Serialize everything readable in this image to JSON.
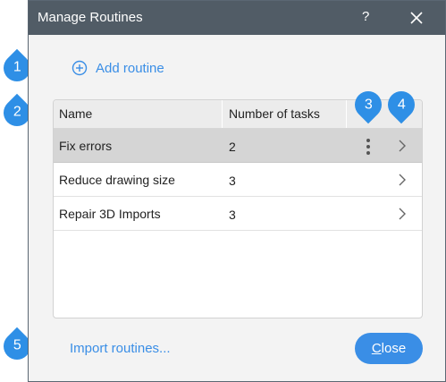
{
  "window": {
    "title": "Manage Routines",
    "help_label": "?"
  },
  "add_routine_label": "Add routine",
  "table": {
    "headers": {
      "name": "Name",
      "count": "Number of tasks"
    },
    "rows": [
      {
        "name": "Fix errors",
        "count": "2",
        "selected": true
      },
      {
        "name": "Reduce drawing size",
        "count": "3",
        "selected": false
      },
      {
        "name": "Repair 3D Imports",
        "count": "3",
        "selected": false
      }
    ]
  },
  "footer": {
    "import_label": "Import routines...",
    "close_label": "Close",
    "close_mnemonic": "C",
    "close_rest": "lose"
  },
  "callouts": [
    "1",
    "2",
    "3",
    "4",
    "5"
  ],
  "colors": {
    "accent": "#3a8ee6",
    "titlebar": "#515c66",
    "callout": "#2e8fe6",
    "selected_row": "#d5d5d5"
  },
  "icons": [
    "add-circle-icon",
    "close-icon",
    "more-vertical-icon",
    "chevron-right-icon"
  ]
}
